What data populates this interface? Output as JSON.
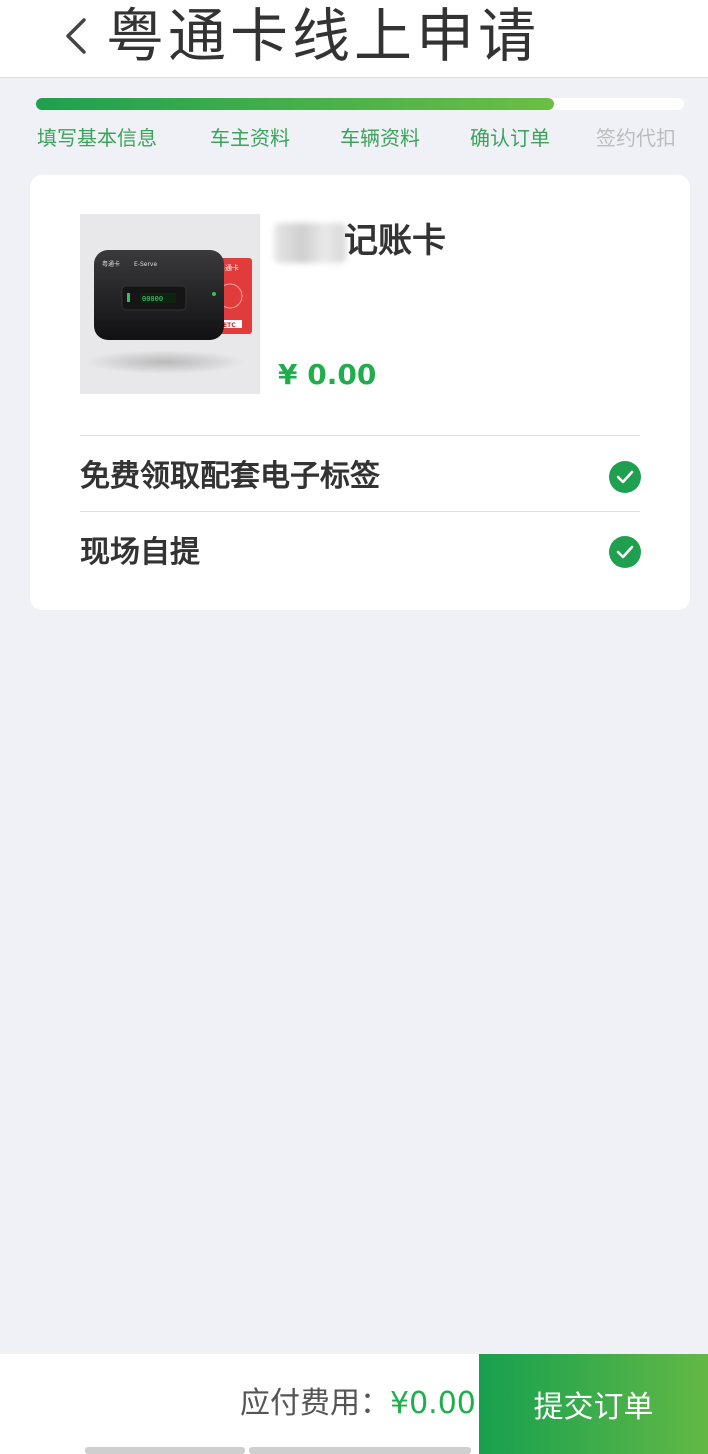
{
  "header": {
    "title": "粤通卡线上申请",
    "back_icon": "chevron-left-icon"
  },
  "progress": {
    "fraction": 0.8,
    "colors": {
      "active": "#1ea04f",
      "inactive_text": "#bcbcbc",
      "track": "#ffffff"
    },
    "steps": [
      {
        "label": "填写基本信息",
        "done": true
      },
      {
        "label": "车主资料",
        "done": true
      },
      {
        "label": "车辆资料",
        "done": true
      },
      {
        "label": "确认订单",
        "done": true
      },
      {
        "label": "签约代扣",
        "done": false
      }
    ]
  },
  "product": {
    "name_visible": "记账卡",
    "price": "¥ 0.00",
    "image_texts": {
      "device_brand": "粤通卡",
      "device_sub": "E-Serve",
      "card_brand": "粤通卡",
      "card_logo": "ETC",
      "screen": "00000"
    }
  },
  "options": [
    {
      "label": "免费领取配套电子标签",
      "checked": true,
      "icon": "check-circle-icon"
    },
    {
      "label": "现场自提",
      "checked": true,
      "icon": "check-circle-icon"
    }
  ],
  "footer": {
    "payable_label": "应付费用：",
    "payable_amount": "¥0.00",
    "submit_label": "提交订单"
  },
  "theme": {
    "accent": "#1fae4b",
    "background": "#f0f1f6"
  }
}
